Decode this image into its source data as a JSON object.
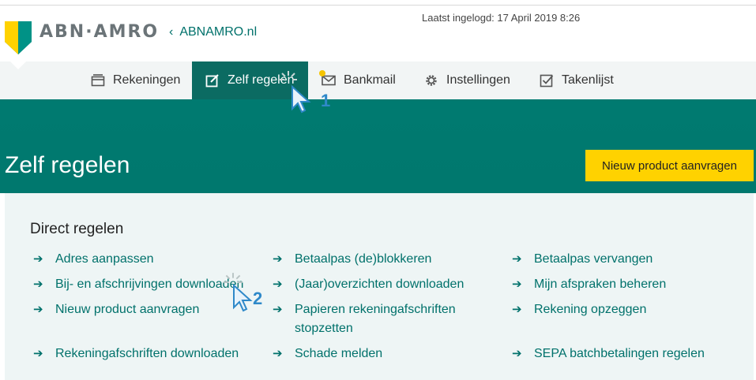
{
  "header": {
    "logo_text": "ABN·AMRO",
    "back_link": "ABNAMRO.nl",
    "last_login": "Laatst ingelogd: 17 April 2019 8:26"
  },
  "nav": [
    {
      "label": "Rekeningen",
      "icon": "wallet-icon"
    },
    {
      "label": "Zelf regelen",
      "icon": "edit-icon",
      "active": true
    },
    {
      "label": "Bankmail",
      "icon": "mail-icon"
    },
    {
      "label": "Instellingen",
      "icon": "gear-icon"
    },
    {
      "label": "Takenlijst",
      "icon": "checkbox-icon"
    }
  ],
  "hero": {
    "title": "Zelf regelen",
    "button": "Nieuw product aanvragen"
  },
  "panel": {
    "title": "Direct regelen",
    "links": [
      "Adres aanpassen",
      "Betaalpas (de)blokkeren",
      "Betaalpas vervangen",
      "Bij- en afschrijvingen downloaden",
      "(Jaar)overzichten downloaden",
      "Mijn afspraken beheren",
      "Nieuw product aanvragen",
      "Papieren rekeningafschriften stopzetten",
      "Rekening opzeggen",
      "Rekeningafschriften downloaden",
      "Schade melden",
      "SEPA batchbetalingen regelen"
    ]
  },
  "annotations": {
    "step1": "1",
    "step2": "2"
  },
  "colors": {
    "brand_green": "#00716b",
    "brand_yellow": "#ffd200",
    "cursor_blue": "#2f89c9"
  }
}
